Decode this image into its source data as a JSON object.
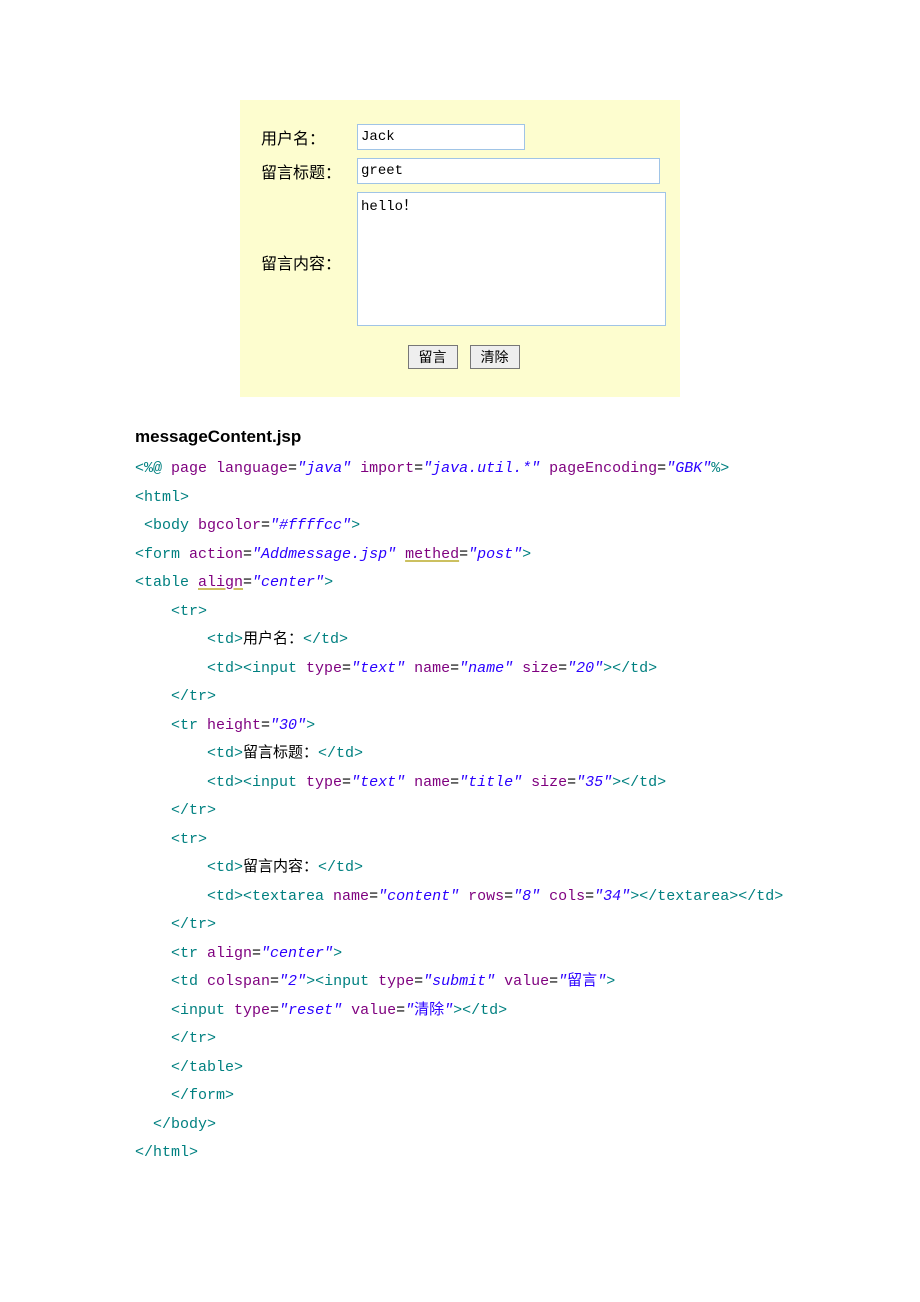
{
  "form": {
    "labels": {
      "username": "用户名：",
      "title": "留言标题：",
      "content": "留言内容："
    },
    "values": {
      "username": "Jack",
      "title": "greet",
      "content": "hello！"
    },
    "buttons": {
      "submit": "留言",
      "reset": "清除"
    }
  },
  "filename": "messageContent.jsp",
  "code": {
    "l1": {
      "a": "<%@ ",
      "b": "page ",
      "c": "language",
      "d": "=",
      "e": "\"java\"",
      "f": " import",
      "g": "=",
      "h": "\"java.util.*\"",
      "i": " pageEncoding",
      "j": "=",
      "k": "\"GBK\"",
      "l": "%>"
    },
    "l2": "<html>",
    "l3": {
      "a": " <body ",
      "b": "bgcolor",
      "c": "=",
      "d": "\"#ffffcc\"",
      "e": ">"
    },
    "l4": {
      "a": "<form ",
      "b": "action",
      "c": "=",
      "d": "\"Addmessage.jsp\"",
      "e": " ",
      "f": "methed",
      "g": "=",
      "h": "\"post\"",
      "i": ">"
    },
    "l5": {
      "a": "<table ",
      "b": "align",
      "c": "=",
      "d": "\"center\"",
      "e": ">"
    },
    "l6": "    <tr>",
    "l7": {
      "a": "        <td>",
      "b": "用户名：",
      "c": "</td>"
    },
    "l8": {
      "a": "        <td><input ",
      "b": "type",
      "c": "=",
      "d": "\"text\"",
      "e": " name",
      "f": "=",
      "g": "\"name\"",
      "h": " size",
      "i": "=",
      "j": "\"20\"",
      "k": "></td>"
    },
    "l9": "    </tr>",
    "l10": {
      "a": "    <tr ",
      "b": "height",
      "c": "=",
      "d": "\"30\"",
      "e": ">"
    },
    "l11": {
      "a": "        <td>",
      "b": "留言标题：",
      "c": "</td>"
    },
    "l12": {
      "a": "        <td><input ",
      "b": "type",
      "c": "=",
      "d": "\"text\"",
      "e": " name",
      "f": "=",
      "g": "\"title\"",
      "h": " size",
      "i": "=",
      "j": "\"35\"",
      "k": "></td>"
    },
    "l13": "    </tr>",
    "l14": "    <tr>",
    "l15": {
      "a": "        <td>",
      "b": "留言内容：",
      "c": "</td>"
    },
    "l16": {
      "a": "        <td><textarea ",
      "b": "name",
      "c": "=",
      "d": "\"content\"",
      "e": " rows",
      "f": "=",
      "g": "\"8\"",
      "h": " cols",
      "i": "=",
      "j": "\"34\"",
      "k": "></textarea></td>"
    },
    "l17": "    </tr>",
    "l18": {
      "a": "    <tr ",
      "b": "align",
      "c": "=",
      "d": "\"center\"",
      "e": ">"
    },
    "l19": {
      "a": "    <td ",
      "b": "colspan",
      "c": "=",
      "d": "\"2\"",
      "e": "><input ",
      "f": "type",
      "g": "=",
      "h": "\"submit\"",
      "i": " value",
      "j": "=",
      "k": "\"",
      "l": "留言",
      "m": "\"",
      "n": ">"
    },
    "l20": {
      "a": "    <input ",
      "b": "type",
      "c": "=",
      "d": "\"reset\"",
      "e": " value",
      "f": "=",
      "g": "\"",
      "h": "清除",
      "i": "\"",
      "j": "></td>"
    },
    "l21": "    </tr>",
    "l22": "    </table>",
    "l23": "    </form>",
    "l24": "  </body>",
    "l25": "</html>"
  }
}
